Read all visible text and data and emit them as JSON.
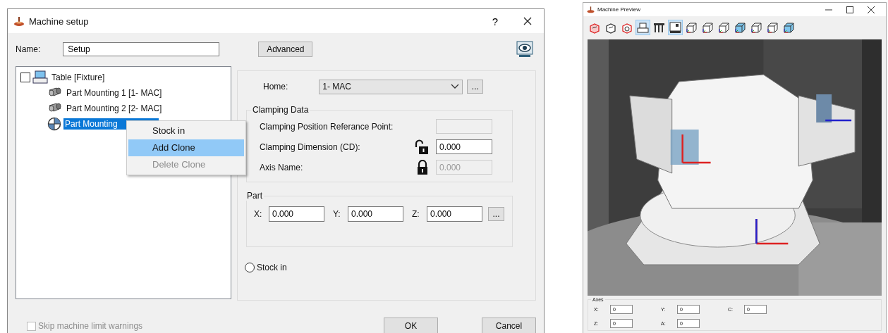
{
  "dialog": {
    "title": "Machine setup",
    "help": "?",
    "name_label": "Name:",
    "name_value": "Setup",
    "advanced": "Advanced",
    "tree": [
      {
        "label": "Table [Fixture]",
        "kind": "table",
        "checked": false,
        "selected": false,
        "children": [
          {
            "label": "Part Mounting 1 [1- MAC]",
            "kind": "mounting",
            "selected": false
          },
          {
            "label": "Part Mounting 2 [2- MAC]",
            "kind": "mounting",
            "selected": false
          },
          {
            "label": "Part Mounting",
            "kind": "target",
            "selected": true
          }
        ]
      }
    ],
    "context_menu": [
      {
        "label": "Stock in",
        "selected": false,
        "disabled": false
      },
      {
        "label": "Add Clone",
        "selected": true,
        "disabled": false
      },
      {
        "label": "Delete Clone",
        "selected": false,
        "disabled": true
      }
    ],
    "home": {
      "label": "Home:",
      "value": "1- MAC",
      "more": "..."
    },
    "clamping": {
      "title": "Clamping Data",
      "rows": [
        {
          "label": "Clamping Position Referance Point:",
          "kind": "plain",
          "disabled": true
        },
        {
          "label": "Clamping Dimension (CD):",
          "kind": "unlocked",
          "value": "0.000",
          "disabled": false
        },
        {
          "label": "Axis Name:",
          "kind": "locked",
          "value": "0.000",
          "disabled": true
        }
      ]
    },
    "part": {
      "title": "Part",
      "fields": [
        {
          "label": "X:",
          "value": "0.000"
        },
        {
          "label": "Y:",
          "value": "0.000"
        },
        {
          "label": "Z:",
          "value": "0.000"
        }
      ],
      "more": "..."
    },
    "stock_in": {
      "label": "Stock in",
      "selected": false
    },
    "skip_warnings": {
      "label": "Skip machine limit warnings",
      "checked": false,
      "disabled": true
    },
    "buttons": [
      "OK",
      "Cancel"
    ]
  },
  "preview": {
    "title": "Machine Preview",
    "toolbar": [
      {
        "kind": "rotate-red",
        "selected": false
      },
      {
        "kind": "rotate",
        "selected": false
      },
      {
        "kind": "dial",
        "selected": false
      },
      {
        "kind": "printer",
        "selected": true
      },
      {
        "kind": "fixture",
        "selected": false
      },
      {
        "kind": "panel",
        "selected": true
      },
      {
        "kind": "cube",
        "selected": false
      },
      {
        "kind": "cube",
        "selected": false
      },
      {
        "kind": "cube",
        "selected": false
      },
      {
        "kind": "cube-filled",
        "selected": false
      },
      {
        "kind": "cube",
        "selected": false
      },
      {
        "kind": "cube",
        "selected": false
      },
      {
        "kind": "cube-filled",
        "selected": false
      }
    ],
    "axes": {
      "title": "Axes",
      "rows": [
        [
          {
            "label": "X:",
            "value": "0"
          },
          {
            "label": "Y:",
            "value": "0"
          },
          {
            "label": "C:",
            "value": "0"
          }
        ],
        [
          {
            "label": "Z:",
            "value": "0"
          },
          {
            "label": "A:",
            "value": "0"
          }
        ]
      ]
    }
  }
}
